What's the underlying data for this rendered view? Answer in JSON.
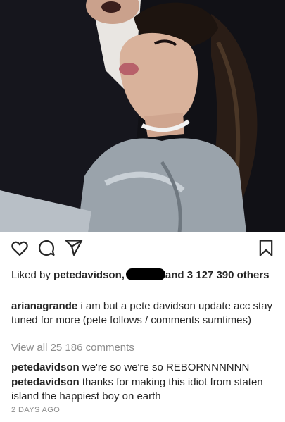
{
  "post": {
    "image_description_icon": "photo",
    "likes": {
      "prefix": "Liked by ",
      "first_user": "petedavidson,",
      "suffix": "and 3 127 390 others"
    },
    "caption": {
      "user": "arianagrande",
      "text": " i am but a pete davidson update acc stay tuned for more (pete follows / comments sumtimes)"
    },
    "view_all": "View all 25 186 comments",
    "comments": [
      {
        "user": "petedavidson",
        "text": " we're so we're so REBORNNNNNN"
      },
      {
        "user": "petedavidson",
        "text": " thanks for making this idiot from staten island the happiest boy on earth"
      }
    ],
    "timestamp": "2 DAYS AGO"
  },
  "icons": {
    "like": "heart-icon",
    "comment": "comment-icon",
    "share": "share-icon",
    "save": "bookmark-icon"
  }
}
